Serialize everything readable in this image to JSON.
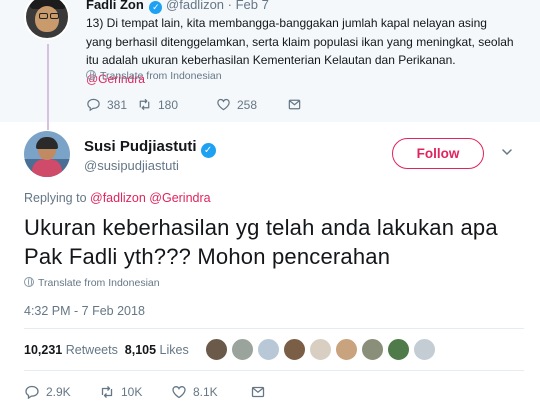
{
  "parent": {
    "name": "Fadli Zon",
    "handle": "@fadlizon",
    "date": "· Feb 7",
    "text_main": "13) Di tempat lain, kita membangga-banggakan jumlah kapal nelayan asing yang berhasil ditenggelamkan, serta klaim populasi ikan yang meningkat, seolah itu adalah ukuran keberhasilan Kementerian Kelautan dan Perikanan. ",
    "text_mention": "@Gerindra",
    "translate": "Translate from Indonesian",
    "replies": "381",
    "retweets": "180",
    "likes": "258"
  },
  "tweet": {
    "name": "Susi Pudjiastuti",
    "handle": "@susipudjiastuti",
    "follow_label": "Follow",
    "replying_prefix": "Replying to ",
    "replying_user1": "@fadlizon",
    "replying_user2": "@Gerindra",
    "text": "Ukuran keberhasilan yg telah anda lakukan apa Pak Fadli yth??? Mohon pencerahan",
    "translate": "Translate from Indonesian",
    "timestamp": "4:32 PM - 7 Feb 2018",
    "retweet_count": "10,231",
    "retweet_label": "Retweets",
    "like_count": "8,105",
    "like_label": "Likes",
    "replies": "2.9K",
    "retweets": "10K",
    "likes": "8.1K"
  },
  "colors": {
    "accent": "#e0245e",
    "verified": "#1da1f2",
    "muted": "#657786",
    "parent_bg": "#f5f8fa"
  },
  "icons": {
    "verified": "verified-badge-icon",
    "translate": "globe-icon",
    "reply": "reply-icon",
    "retweet": "retweet-icon",
    "like": "heart-icon",
    "message": "envelope-icon",
    "more": "chevron-down-icon"
  }
}
